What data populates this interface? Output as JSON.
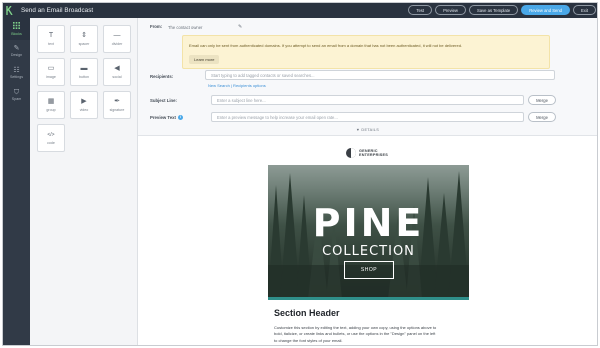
{
  "app": {
    "title": "Send an Email Broadcast"
  },
  "topbar": {
    "buttons": [
      {
        "label": "Test"
      },
      {
        "label": "Preview"
      },
      {
        "label": "Save as Template"
      },
      {
        "label": "Review and Send"
      },
      {
        "label": "Exit"
      }
    ],
    "primary_color": "#4aa8e8"
  },
  "rail": {
    "items": [
      {
        "label": "Blocks",
        "icon": "grid-icon"
      },
      {
        "label": "Design",
        "icon": "brush-icon"
      },
      {
        "label": "Settings",
        "icon": "sliders-icon"
      },
      {
        "label": "Spam",
        "icon": "shield-icon"
      }
    ]
  },
  "palette": {
    "tiles": [
      {
        "label": "text",
        "glyph": "T"
      },
      {
        "label": "spacer",
        "glyph": "⇕"
      },
      {
        "label": "divider",
        "glyph": "—"
      },
      {
        "label": "image",
        "glyph": "▭"
      },
      {
        "label": "button",
        "glyph": "▬"
      },
      {
        "label": "social",
        "glyph": "◀"
      },
      {
        "label": "group",
        "glyph": "▦"
      },
      {
        "label": "video",
        "glyph": "▶"
      },
      {
        "label": "signature",
        "glyph": "✒"
      },
      {
        "label": "code",
        "glyph": "</>"
      }
    ]
  },
  "settings": {
    "from_label": "From:",
    "from_value": "The contact owner",
    "warning_text": "Email can only be sent from authenticated domains. If you attempt to send an email from a domain that has not been authenticated, it will not be delivered.",
    "learn_more": "Learn more",
    "recipients_label": "Recipients:",
    "recipients_placeholder": "Start typing to add tagged contacts or saved searches...",
    "recipients_links": "New Search | Recipients options",
    "subject_label": "Subject Line:",
    "subject_placeholder": "Enter a subject line here...",
    "preview_label": "Preview Text",
    "preview_placeholder": "Enter a preview message to help increase your email open rate...",
    "merge_label": "Merge",
    "details_label": "▼ DETAILS"
  },
  "email": {
    "brand_line1": "GENERIC",
    "brand_line2": "ENTERPRISES",
    "hero_title": "PINE",
    "hero_subtitle": "COLLECTION",
    "shop_label": "SHOP",
    "section_header": "Section Header",
    "body_line1": "Customize this section by editing the text, adding your own copy, using the options above to",
    "body_line2": "bold, italicize, or create links and bullets, or use the options in the \"Design\" panel on the left",
    "body_line3": "to change the font styles of your email."
  }
}
